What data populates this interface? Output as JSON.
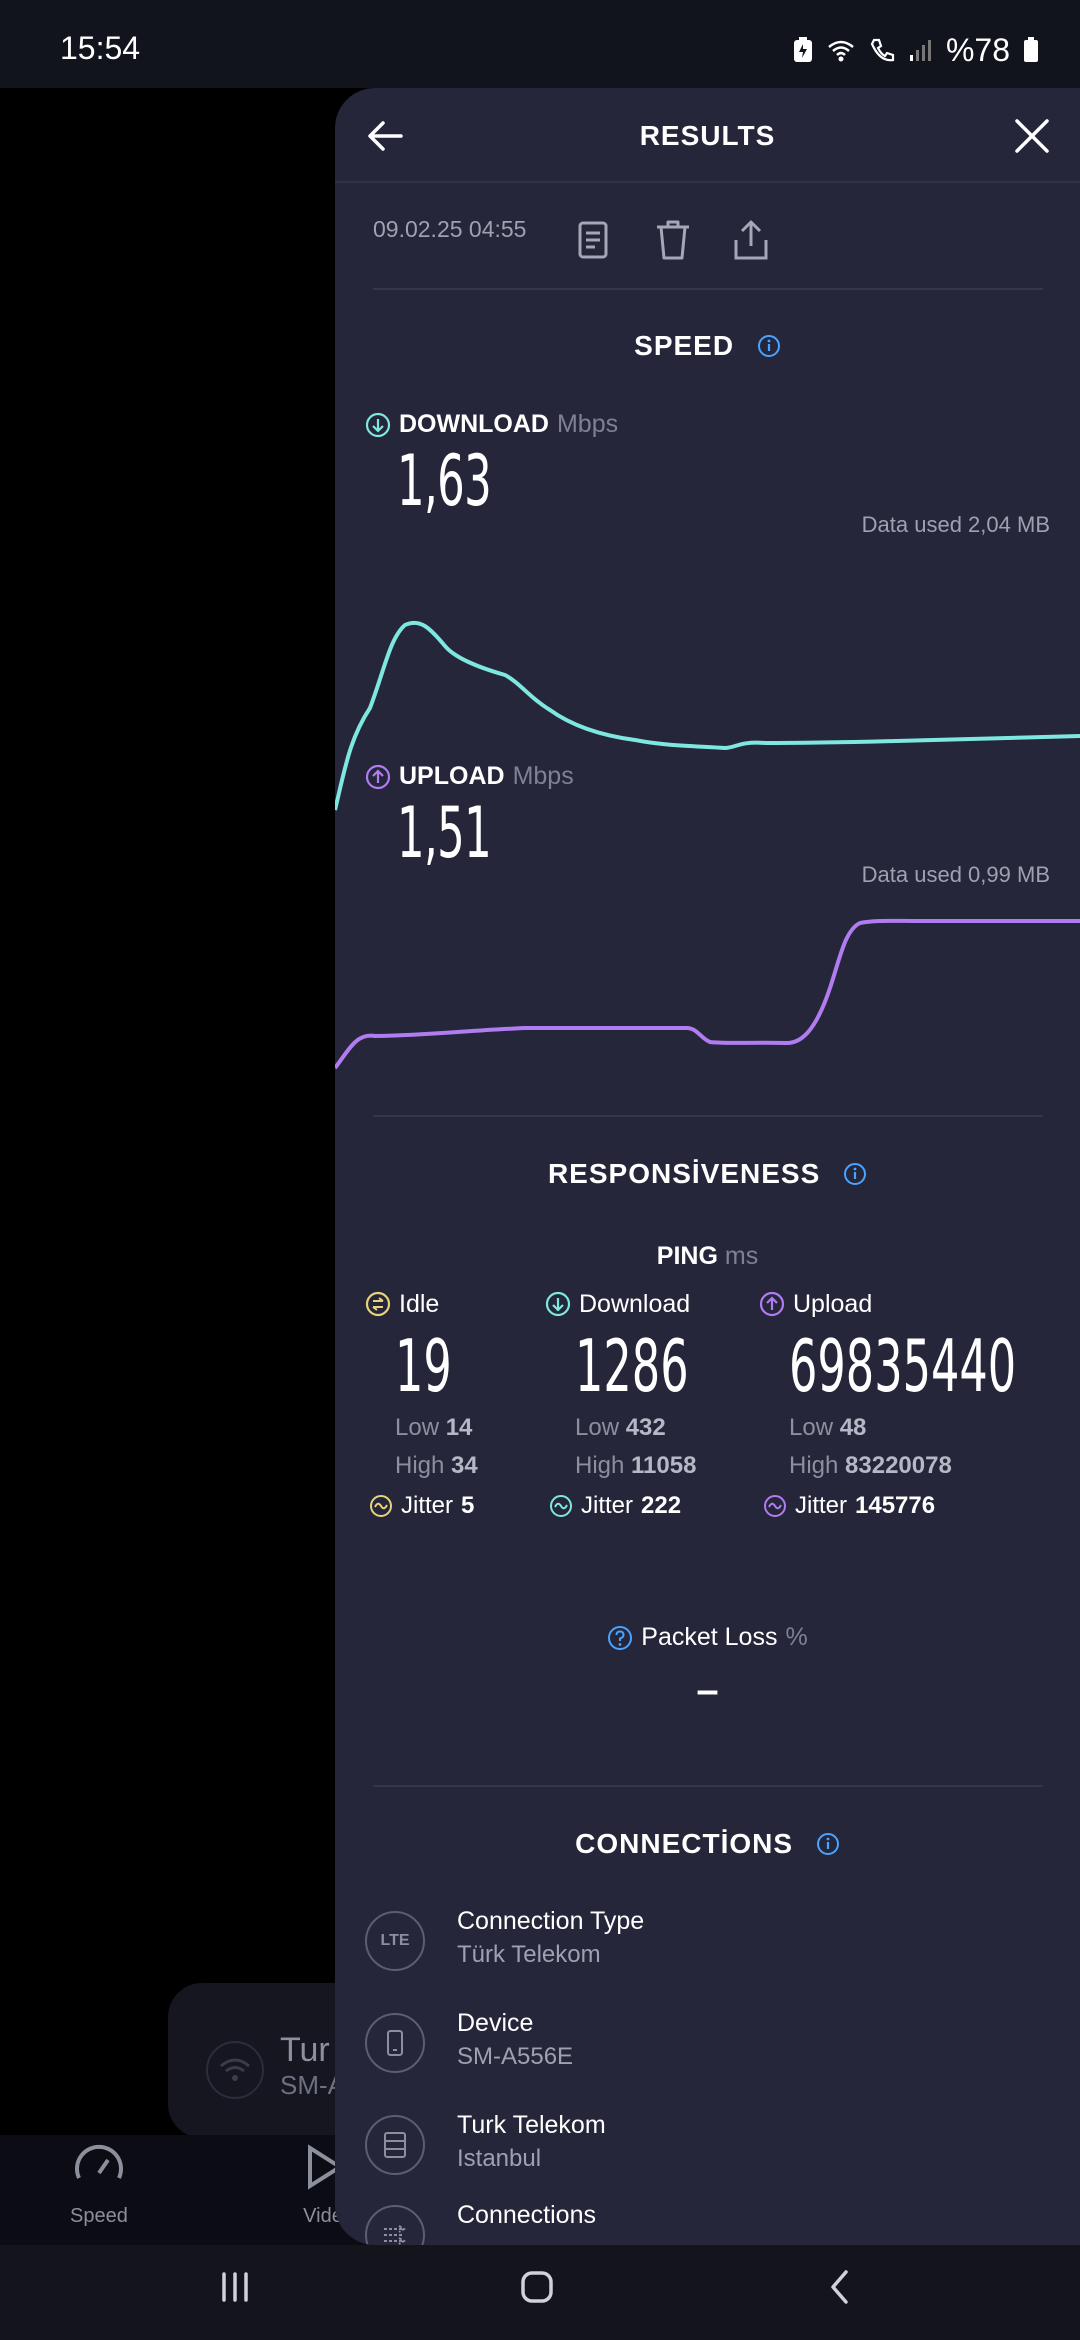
{
  "status_bar": {
    "time": "15:54",
    "battery": "%78"
  },
  "background_app": {
    "card_title": "Tur",
    "card_subtitle": "SM-A",
    "nav": [
      {
        "label": "Speed",
        "icon": "speedometer-icon"
      },
      {
        "label": "Vide",
        "icon": "play-icon"
      }
    ]
  },
  "panel": {
    "title": "RESULTS",
    "date": "09.02.25 04:55",
    "actions": [
      "report-icon",
      "trash-icon",
      "share-icon"
    ]
  },
  "speed": {
    "section_title": "SPEED",
    "download": {
      "label": "DOWNLOAD",
      "unit": "Mbps",
      "value": "1,63",
      "data_used": "Data used 2,04 MB",
      "color": "#7ee8e0"
    },
    "upload": {
      "label": "UPLOAD",
      "unit": "Mbps",
      "value": "1,51",
      "data_used": "Data used 0,99 MB",
      "color": "#b07cf0"
    }
  },
  "responsiveness": {
    "section_title": "RESPONSİVENESS",
    "ping_label": "PING",
    "ping_unit": "ms",
    "columns": [
      {
        "label": "Idle",
        "value": "19",
        "low_label": "Low",
        "low": "14",
        "high_label": "High",
        "high": "34",
        "jitter_label": "Jitter",
        "jitter": "5",
        "color": "#e8d27a"
      },
      {
        "label": "Download",
        "value": "1286",
        "low_label": "Low",
        "low": "432",
        "high_label": "High",
        "high": "11058",
        "jitter_label": "Jitter",
        "jitter": "222",
        "color": "#7ee8e0"
      },
      {
        "label": "Upload",
        "value": "69835440",
        "low_label": "Low",
        "low": "48",
        "high_label": "High",
        "high": "83220078",
        "jitter_label": "Jitter",
        "jitter": "145776",
        "color": "#b07cf0"
      }
    ],
    "packet_loss_label": "Packet Loss",
    "packet_loss_unit": "%",
    "packet_loss_value": "–"
  },
  "connections": {
    "section_title": "CONNECTİONS",
    "items": [
      {
        "title": "Connection Type",
        "subtitle": "Türk Telekom",
        "icon_text": "LTE"
      },
      {
        "title": "Device",
        "subtitle": "SM-A556E",
        "icon_text": ""
      },
      {
        "title": "Turk Telekom",
        "subtitle": "Istanbul",
        "icon_text": ""
      },
      {
        "title": "Connections",
        "subtitle": "",
        "icon_text": ""
      }
    ]
  }
}
